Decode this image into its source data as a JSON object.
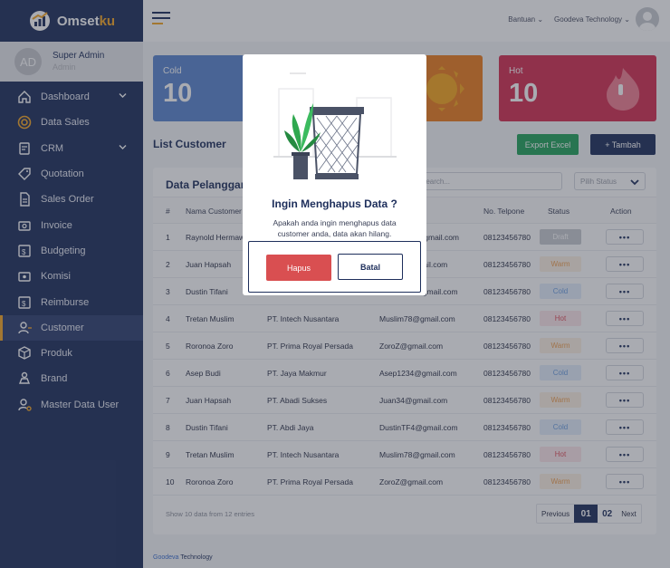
{
  "app": {
    "brand_main": "Omset",
    "brand_accent": "ku"
  },
  "colors": {
    "sidebar": "#1d2e5b",
    "accent": "#f5a623",
    "cold": "#5b86cf",
    "warm": "#ec7c1c",
    "hot": "#d42d50",
    "green": "#21a35a",
    "danger": "#d94f51"
  },
  "profile": {
    "initials": "AD",
    "name": "Super Admin",
    "role": "Admin"
  },
  "sidebar": {
    "items": [
      {
        "label": "Dashboard",
        "icon": "home-icon",
        "has_chevron": true
      },
      {
        "label": "Data Sales",
        "icon": "target-icon",
        "has_chevron": false
      },
      {
        "label": "CRM",
        "icon": "clipboard-icon",
        "has_chevron": true
      },
      {
        "label": "Quotation",
        "icon": "tag-icon",
        "has_chevron": false
      },
      {
        "label": "Sales Order",
        "icon": "document-icon",
        "has_chevron": false
      },
      {
        "label": "Invoice",
        "icon": "invoice-icon",
        "has_chevron": false
      },
      {
        "label": "Budgeting",
        "icon": "budget-icon",
        "has_chevron": false
      },
      {
        "label": "Komisi",
        "icon": "cash-icon",
        "has_chevron": false
      },
      {
        "label": "Reimburse",
        "icon": "reimburse-icon",
        "has_chevron": false
      },
      {
        "label": "Customer",
        "icon": "users-icon",
        "has_chevron": false,
        "active": true
      },
      {
        "label": "Produk",
        "icon": "box-icon",
        "has_chevron": false
      },
      {
        "label": "Brand",
        "icon": "brand-icon",
        "has_chevron": false
      },
      {
        "label": "Master Data User",
        "icon": "user-settings-icon",
        "has_chevron": false
      }
    ]
  },
  "topbar": {
    "help": "Bantuan",
    "company": "Goodeva Technology"
  },
  "stats": [
    {
      "label": "Cold",
      "value": "10"
    },
    {
      "label": "Hot",
      "value": "10"
    }
  ],
  "list": {
    "title": "List Customer",
    "export_label": "Export Excel",
    "add_label": "+ Tambah"
  },
  "table": {
    "title": "Data Pelanggan",
    "search_placeholder": "Search...",
    "status_placeholder": "Pilih Status",
    "headers": [
      "#",
      "Nama Customer",
      "",
      "",
      "No. Telpone",
      "Status",
      "Action"
    ],
    "rows": [
      {
        "no": "1",
        "name": "Raynold Hermawan",
        "company": "",
        "email": "Raynold34@gmail.com",
        "phone": "08123456780",
        "status": "Draft"
      },
      {
        "no": "2",
        "name": "Juan Hapsah",
        "company": "",
        "email": "Juan34@gmail.com",
        "phone": "08123456780",
        "status": "Warm"
      },
      {
        "no": "3",
        "name": "Dustin Tifani",
        "company": "",
        "email": "DustinTF4@gmail.com",
        "phone": "08123456780",
        "status": "Cold"
      },
      {
        "no": "4",
        "name": "Tretan Muslim",
        "company": "PT. Intech Nusantara",
        "email": "Muslim78@gmail.com",
        "phone": "08123456780",
        "status": "Hot"
      },
      {
        "no": "5",
        "name": "Roronoa Zoro",
        "company": "PT. Prima Royal Persada",
        "email": "ZoroZ@gmail.com",
        "phone": "08123456780",
        "status": "Warm"
      },
      {
        "no": "6",
        "name": "Asep Budi",
        "company": "PT. Jaya Makmur",
        "email": "Asep1234@gmail.com",
        "phone": "08123456780",
        "status": "Cold"
      },
      {
        "no": "7",
        "name": "Juan Hapsah",
        "company": "PT. Abadi Sukses",
        "email": "Juan34@gmail.com",
        "phone": "08123456780",
        "status": "Warm"
      },
      {
        "no": "8",
        "name": "Dustin Tifani",
        "company": "PT. Abdi Jaya",
        "email": "DustinTF4@gmail.com",
        "phone": "08123456780",
        "status": "Cold"
      },
      {
        "no": "9",
        "name": "Tretan Muslim",
        "company": "PT. Intech Nusantara",
        "email": "Muslim78@gmail.com",
        "phone": "08123456780",
        "status": "Hot"
      },
      {
        "no": "10",
        "name": "Roronoa Zoro",
        "company": "PT. Prima Royal Persada",
        "email": "ZoroZ@gmail.com",
        "phone": "08123456780",
        "status": "Warm"
      }
    ],
    "action_label": "•••",
    "footer": "Show 10 data from 12 entries"
  },
  "pagination": {
    "previous": "Previous",
    "pages": [
      "01",
      "02"
    ],
    "current": "01",
    "next": "Next"
  },
  "copyright": {
    "accent": "Goodeva",
    "rest": " Technology"
  },
  "modal": {
    "title": "Ingin Menghapus Data ?",
    "message": "Apakah anda ingin menghapus data customer anda, data akan hilang.",
    "confirm_label": "Hapus",
    "cancel_label": "Batal"
  }
}
